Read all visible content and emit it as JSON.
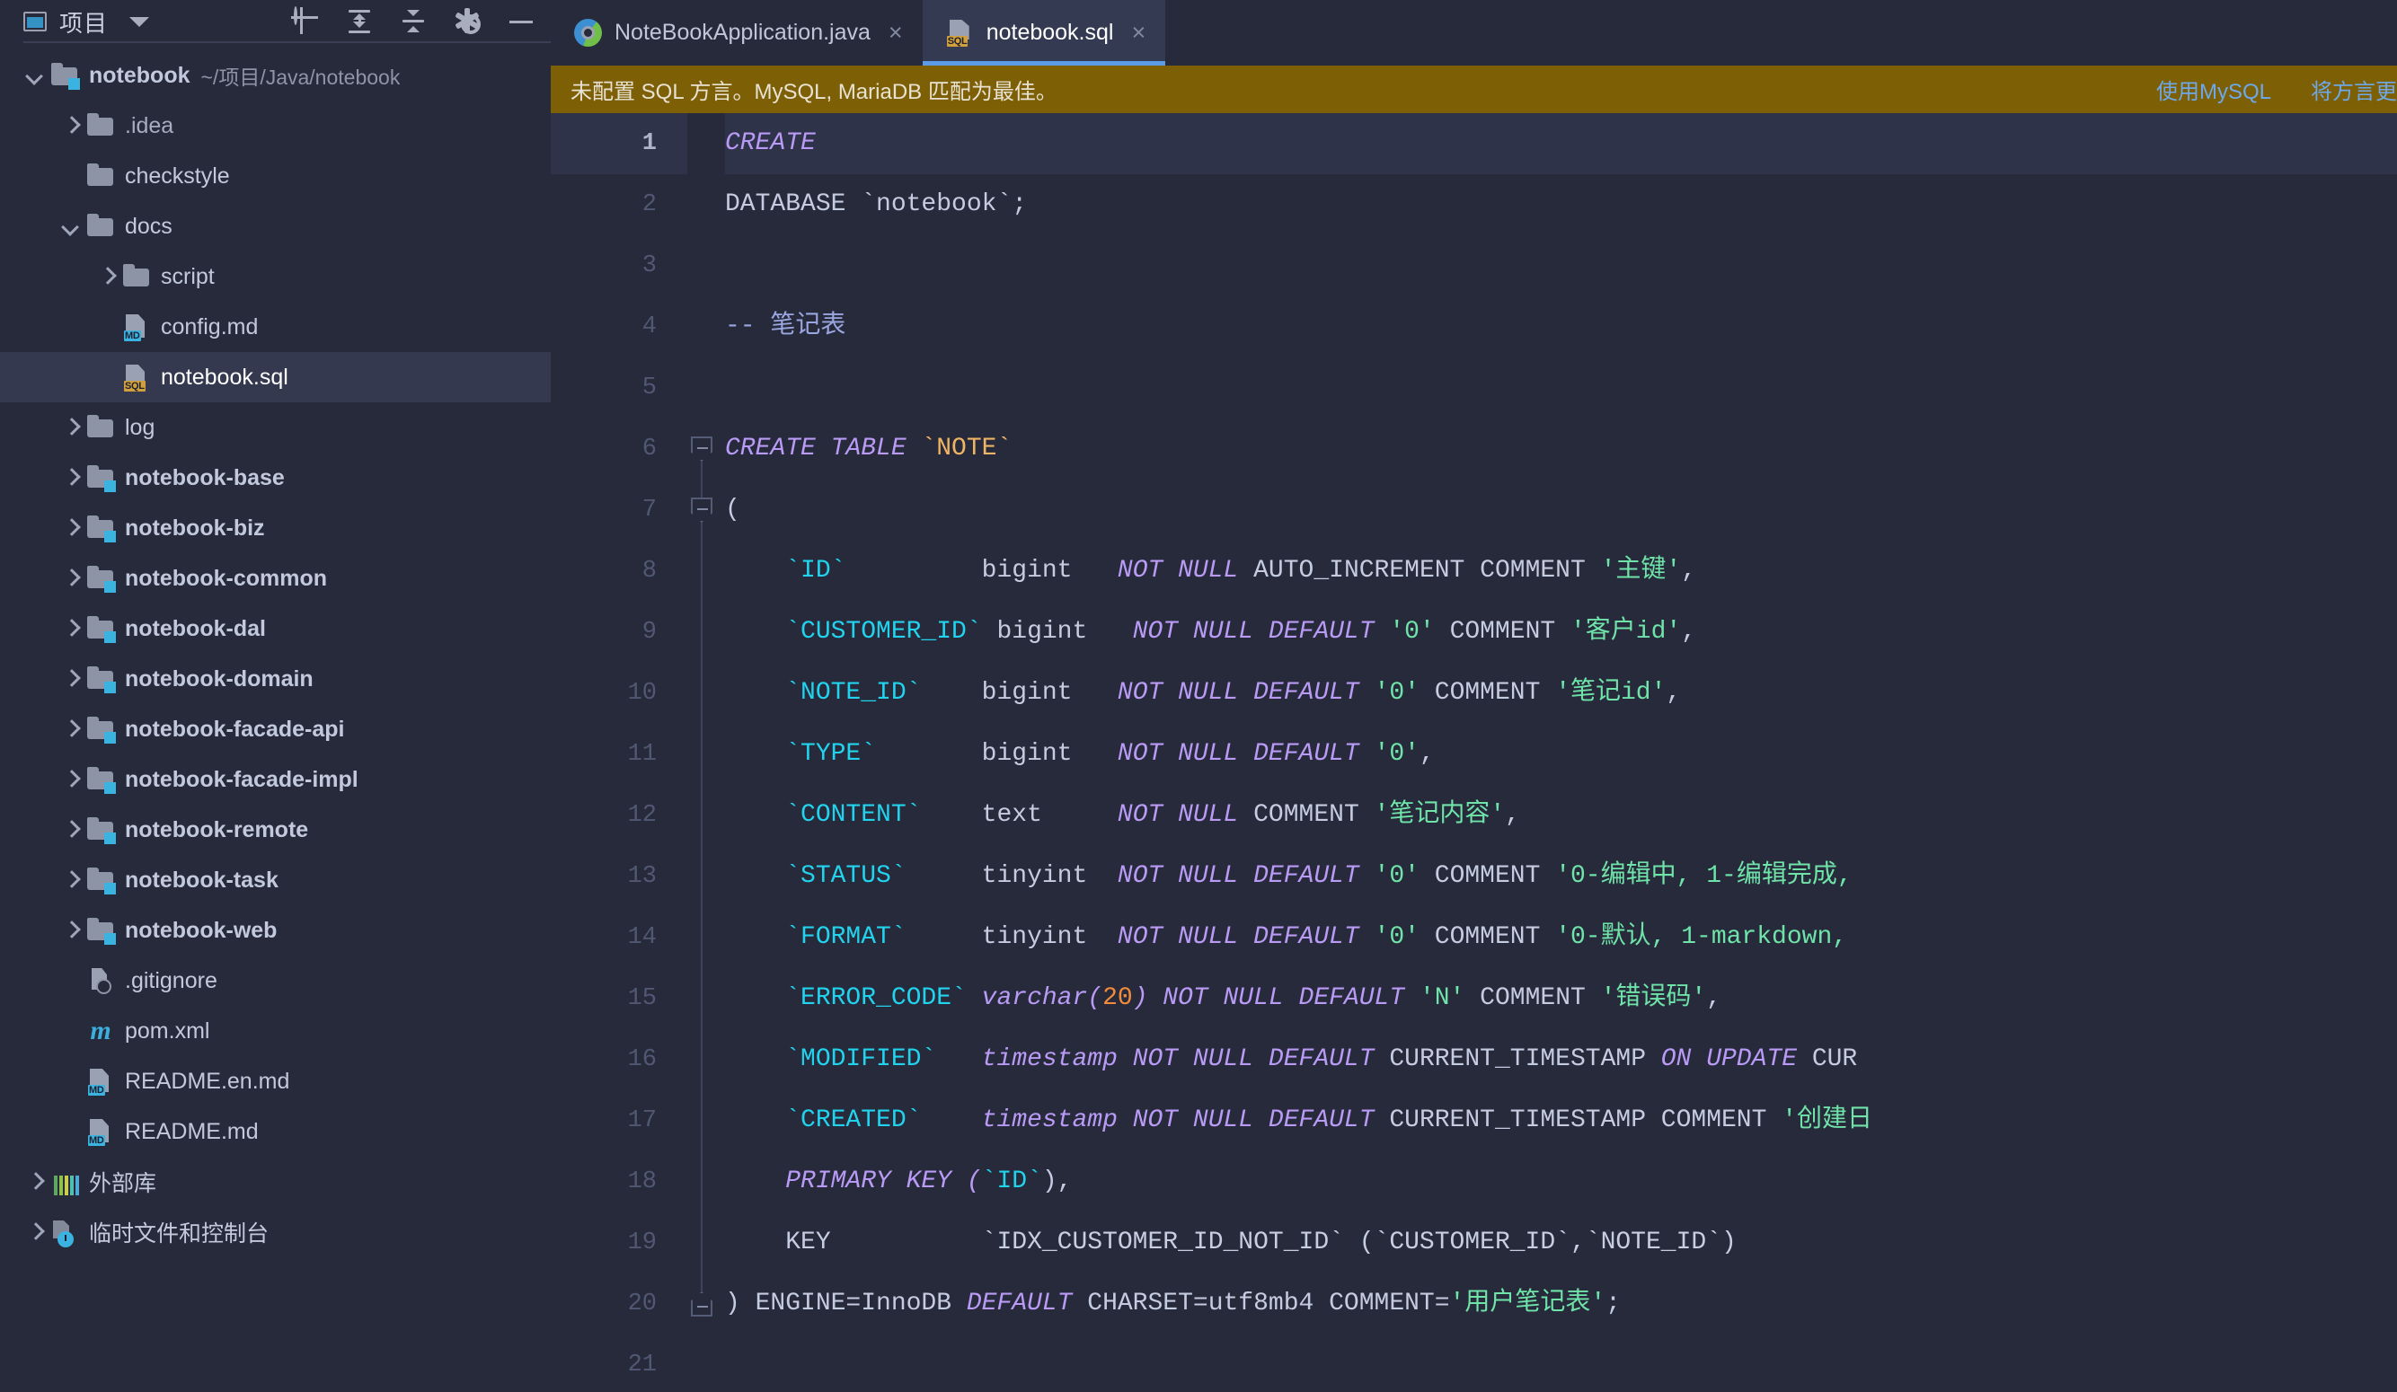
{
  "sidebar": {
    "title": "项目",
    "caret_icon": "chevron-down-icon",
    "tools": [
      {
        "name": "locate-icon",
        "label": "定位"
      },
      {
        "name": "expand-all-icon",
        "label": "全部展开"
      },
      {
        "name": "collapse-all-icon",
        "label": "全部折叠"
      },
      {
        "name": "settings-gear-icon",
        "label": "设置"
      },
      {
        "name": "hide-panel-icon",
        "label": "隐藏"
      }
    ],
    "tree": [
      {
        "label": "notebook",
        "path": "~/项目/Java/notebook",
        "icon": "module-folder-icon",
        "arrow": "down",
        "depth": 0,
        "bold": true,
        "selected": false
      },
      {
        "label": ".idea",
        "path": "",
        "icon": "folder-icon",
        "arrow": "right",
        "depth": 1,
        "bold": false,
        "selected": false,
        "muted": true
      },
      {
        "label": "checkstyle",
        "path": "",
        "icon": "folder-icon",
        "arrow": "none",
        "depth": 1,
        "bold": false,
        "selected": false
      },
      {
        "label": "docs",
        "path": "",
        "icon": "folder-icon",
        "arrow": "down",
        "depth": 1,
        "bold": false,
        "selected": false
      },
      {
        "label": "script",
        "path": "",
        "icon": "folder-icon",
        "arrow": "right",
        "depth": 2,
        "bold": false,
        "selected": false
      },
      {
        "label": "config.md",
        "path": "",
        "icon": "markdown-file-icon",
        "arrow": "none",
        "depth": 2,
        "bold": false,
        "selected": false
      },
      {
        "label": "notebook.sql",
        "path": "",
        "icon": "sql-file-icon",
        "arrow": "none",
        "depth": 2,
        "bold": false,
        "selected": true
      },
      {
        "label": "log",
        "path": "",
        "icon": "folder-icon",
        "arrow": "right",
        "depth": 1,
        "bold": false,
        "selected": false
      },
      {
        "label": "notebook-base",
        "path": "",
        "icon": "module-folder-icon",
        "arrow": "right",
        "depth": 1,
        "bold": true,
        "selected": false
      },
      {
        "label": "notebook-biz",
        "path": "",
        "icon": "module-folder-icon",
        "arrow": "right",
        "depth": 1,
        "bold": true,
        "selected": false
      },
      {
        "label": "notebook-common",
        "path": "",
        "icon": "module-folder-icon",
        "arrow": "right",
        "depth": 1,
        "bold": true,
        "selected": false
      },
      {
        "label": "notebook-dal",
        "path": "",
        "icon": "module-folder-icon",
        "arrow": "right",
        "depth": 1,
        "bold": true,
        "selected": false
      },
      {
        "label": "notebook-domain",
        "path": "",
        "icon": "module-folder-icon",
        "arrow": "right",
        "depth": 1,
        "bold": true,
        "selected": false
      },
      {
        "label": "notebook-facade-api",
        "path": "",
        "icon": "module-folder-icon",
        "arrow": "right",
        "depth": 1,
        "bold": true,
        "selected": false
      },
      {
        "label": "notebook-facade-impl",
        "path": "",
        "icon": "module-folder-icon",
        "arrow": "right",
        "depth": 1,
        "bold": true,
        "selected": false
      },
      {
        "label": "notebook-remote",
        "path": "",
        "icon": "module-folder-icon",
        "arrow": "right",
        "depth": 1,
        "bold": true,
        "selected": false
      },
      {
        "label": "notebook-task",
        "path": "",
        "icon": "module-folder-icon",
        "arrow": "right",
        "depth": 1,
        "bold": true,
        "selected": false
      },
      {
        "label": "notebook-web",
        "path": "",
        "icon": "module-folder-icon",
        "arrow": "right",
        "depth": 1,
        "bold": true,
        "selected": false
      },
      {
        "label": ".gitignore",
        "path": "",
        "icon": "gitignore-file-icon",
        "arrow": "none",
        "depth": 1,
        "bold": false,
        "selected": false
      },
      {
        "label": "pom.xml",
        "path": "",
        "icon": "maven-file-icon",
        "arrow": "none",
        "depth": 1,
        "bold": false,
        "selected": false
      },
      {
        "label": "README.en.md",
        "path": "",
        "icon": "markdown-file-icon",
        "arrow": "none",
        "depth": 1,
        "bold": false,
        "selected": false
      },
      {
        "label": "README.md",
        "path": "",
        "icon": "markdown-file-icon",
        "arrow": "none",
        "depth": 1,
        "bold": false,
        "selected": false
      },
      {
        "label": "外部库",
        "path": "",
        "icon": "external-libraries-icon",
        "arrow": "right",
        "depth": 0,
        "bold": false,
        "selected": false
      },
      {
        "label": "临时文件和控制台",
        "path": "",
        "icon": "scratches-consoles-icon",
        "arrow": "right",
        "depth": 0,
        "bold": false,
        "selected": false
      }
    ]
  },
  "tabs": [
    {
      "label": "NoteBookApplication.java",
      "icon": "java-run-file-icon",
      "active": false,
      "close_icon": "×"
    },
    {
      "label": "notebook.sql",
      "icon": "sql-file-icon",
      "active": true,
      "close_icon": "×"
    }
  ],
  "notification": {
    "message": "未配置 SQL 方言。MySQL, MariaDB 匹配为最佳。",
    "actions": [
      "使用MySQL",
      "将方言更"
    ],
    "bg_color": "#7D5F06",
    "link_color": "#6EA8E8"
  },
  "editor": {
    "filename": "notebook.sql",
    "current_line": 1,
    "lines": [
      {
        "n": 1,
        "tokens": [
          {
            "t": "CREATE",
            "c": "kw"
          }
        ]
      },
      {
        "n": 2,
        "tokens": [
          {
            "t": "DATABASE `notebook`;",
            "c": "kw2"
          }
        ]
      },
      {
        "n": 3,
        "tokens": []
      },
      {
        "n": 4,
        "tokens": [
          {
            "t": "-- 笔记表",
            "c": "cmt"
          }
        ]
      },
      {
        "n": 5,
        "tokens": []
      },
      {
        "n": 6,
        "tokens": [
          {
            "t": "CREATE TABLE ",
            "c": "kw"
          },
          {
            "t": "`NOTE`",
            "c": "tbl"
          }
        ]
      },
      {
        "n": 7,
        "tokens": [
          {
            "t": "(",
            "c": "kw2"
          }
        ]
      },
      {
        "n": 8,
        "tokens": [
          {
            "t": "    `ID`         ",
            "c": "id"
          },
          {
            "t": "bigint   ",
            "c": "kw2"
          },
          {
            "t": "NOT NULL ",
            "c": "kw"
          },
          {
            "t": "AUTO_INCREMENT COMMENT ",
            "c": "kw2"
          },
          {
            "t": "'主键'",
            "c": "str"
          },
          {
            "t": ",",
            "c": "kw2"
          }
        ]
      },
      {
        "n": 9,
        "tokens": [
          {
            "t": "    `CUSTOMER_ID`",
            "c": "id"
          },
          {
            "t": " bigint   ",
            "c": "kw2"
          },
          {
            "t": "NOT NULL DEFAULT ",
            "c": "kw"
          },
          {
            "t": "'0'",
            "c": "str"
          },
          {
            "t": " COMMENT ",
            "c": "kw2"
          },
          {
            "t": "'客户id'",
            "c": "str"
          },
          {
            "t": ",",
            "c": "kw2"
          }
        ]
      },
      {
        "n": 10,
        "tokens": [
          {
            "t": "    `NOTE_ID`    ",
            "c": "id"
          },
          {
            "t": "bigint   ",
            "c": "kw2"
          },
          {
            "t": "NOT NULL DEFAULT ",
            "c": "kw"
          },
          {
            "t": "'0'",
            "c": "str"
          },
          {
            "t": " COMMENT ",
            "c": "kw2"
          },
          {
            "t": "'笔记id'",
            "c": "str"
          },
          {
            "t": ",",
            "c": "kw2"
          }
        ]
      },
      {
        "n": 11,
        "tokens": [
          {
            "t": "    `TYPE`       ",
            "c": "id"
          },
          {
            "t": "bigint   ",
            "c": "kw2"
          },
          {
            "t": "NOT NULL DEFAULT ",
            "c": "kw"
          },
          {
            "t": "'0'",
            "c": "str"
          },
          {
            "t": ",",
            "c": "kw2"
          }
        ]
      },
      {
        "n": 12,
        "tokens": [
          {
            "t": "    `CONTENT`    ",
            "c": "id"
          },
          {
            "t": "text     ",
            "c": "kw2"
          },
          {
            "t": "NOT NULL ",
            "c": "kw"
          },
          {
            "t": "COMMENT ",
            "c": "kw2"
          },
          {
            "t": "'笔记内容'",
            "c": "str"
          },
          {
            "t": ",",
            "c": "kw2"
          }
        ]
      },
      {
        "n": 13,
        "tokens": [
          {
            "t": "    `STATUS`     ",
            "c": "id"
          },
          {
            "t": "tinyint  ",
            "c": "kw2"
          },
          {
            "t": "NOT NULL DEFAULT ",
            "c": "kw"
          },
          {
            "t": "'0'",
            "c": "str"
          },
          {
            "t": " COMMENT ",
            "c": "kw2"
          },
          {
            "t": "'0-编辑中, 1-编辑完成,",
            "c": "str"
          }
        ]
      },
      {
        "n": 14,
        "tokens": [
          {
            "t": "    `FORMAT`     ",
            "c": "id"
          },
          {
            "t": "tinyint  ",
            "c": "kw2"
          },
          {
            "t": "NOT NULL DEFAULT ",
            "c": "kw"
          },
          {
            "t": "'0'",
            "c": "str"
          },
          {
            "t": " COMMENT ",
            "c": "kw2"
          },
          {
            "t": "'0-默认, 1-markdown,",
            "c": "str"
          }
        ]
      },
      {
        "n": 15,
        "tokens": [
          {
            "t": "    `ERROR_CODE` ",
            "c": "id"
          },
          {
            "t": "varchar(",
            "c": "kw"
          },
          {
            "t": "20",
            "c": "num"
          },
          {
            "t": ") ",
            "c": "kw"
          },
          {
            "t": "NOT NULL DEFAULT ",
            "c": "kw"
          },
          {
            "t": "'N'",
            "c": "str"
          },
          {
            "t": " COMMENT ",
            "c": "kw2"
          },
          {
            "t": "'错误码'",
            "c": "str"
          },
          {
            "t": ",",
            "c": "kw2"
          }
        ]
      },
      {
        "n": 16,
        "tokens": [
          {
            "t": "    `MODIFIED`   ",
            "c": "id"
          },
          {
            "t": "timestamp ",
            "c": "kw"
          },
          {
            "t": "NOT NULL DEFAULT ",
            "c": "kw"
          },
          {
            "t": "CURRENT_TIMESTAMP ",
            "c": "kw2"
          },
          {
            "t": "ON UPDATE ",
            "c": "kw"
          },
          {
            "t": "CUR",
            "c": "kw2"
          }
        ]
      },
      {
        "n": 17,
        "tokens": [
          {
            "t": "    `CREATED`    ",
            "c": "id"
          },
          {
            "t": "timestamp ",
            "c": "kw"
          },
          {
            "t": "NOT NULL DEFAULT ",
            "c": "kw"
          },
          {
            "t": "CURRENT_TIMESTAMP COMMENT ",
            "c": "kw2"
          },
          {
            "t": "'创建日",
            "c": "str"
          }
        ]
      },
      {
        "n": 18,
        "tokens": [
          {
            "t": "    PRIMARY KEY (",
            "c": "kw"
          },
          {
            "t": "`ID`",
            "c": "id"
          },
          {
            "t": "),",
            "c": "kw2"
          }
        ]
      },
      {
        "n": 19,
        "tokens": [
          {
            "t": "    KEY          ",
            "c": "kw2"
          },
          {
            "t": "`IDX_CUSTOMER_ID_NOT_ID` (`CUSTOMER_ID`,`NOTE_ID`)",
            "c": "idx"
          }
        ]
      },
      {
        "n": 20,
        "tokens": [
          {
            "t": ") ENGINE=InnoDB ",
            "c": "kw2"
          },
          {
            "t": "DEFAULT ",
            "c": "kw"
          },
          {
            "t": "CHARSET=utf8mb4 COMMENT=",
            "c": "kw2"
          },
          {
            "t": "'用户笔记表'",
            "c": "str"
          },
          {
            "t": ";",
            "c": "kw2"
          }
        ]
      },
      {
        "n": 21,
        "tokens": []
      }
    ],
    "folds": [
      {
        "line": 6,
        "type": "start"
      },
      {
        "line": 7,
        "type": "start"
      },
      {
        "line": 20,
        "type": "end"
      }
    ],
    "colors": {
      "keyword": "#B99AF5",
      "identifier": "#22D3EE",
      "table": "#F0B564",
      "string": "#6FE3A8",
      "number": "#F28B3C",
      "comment": "#9AA6E0",
      "plain": "#C5CBE0",
      "background": "#262A3B",
      "current_line_bg": "#2E3349"
    }
  }
}
